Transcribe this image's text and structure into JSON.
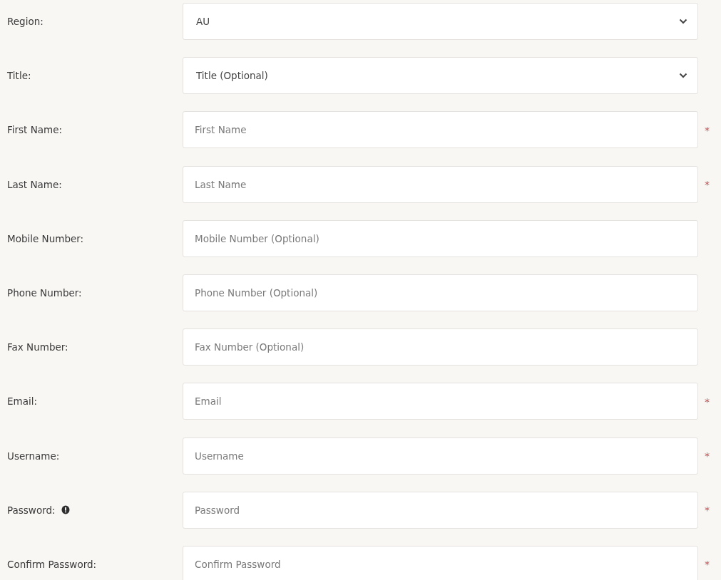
{
  "form": {
    "fields": [
      {
        "label": "Region:",
        "kind": "select",
        "value": "AU"
      },
      {
        "label": "Title:",
        "kind": "select",
        "value": "Title (Optional)"
      },
      {
        "label": "First Name:",
        "kind": "text",
        "placeholder": "First Name",
        "required_mark": "*"
      },
      {
        "label": "Last Name:",
        "kind": "text",
        "placeholder": "Last Name",
        "required_mark": "*"
      },
      {
        "label": "Mobile Number:",
        "kind": "text",
        "placeholder": "Mobile Number (Optional)"
      },
      {
        "label": "Phone Number:",
        "kind": "text",
        "placeholder": "Phone Number (Optional)"
      },
      {
        "label": "Fax Number:",
        "kind": "text",
        "placeholder": "Fax Number (Optional)"
      },
      {
        "label": "Email:",
        "kind": "text",
        "placeholder": "Email",
        "required_mark": "*"
      },
      {
        "label": "Username:",
        "kind": "text",
        "placeholder": "Username",
        "required_mark": "*"
      },
      {
        "label": "Password:",
        "kind": "text",
        "placeholder": "Password",
        "required_mark": "*",
        "info": true
      },
      {
        "label": "Confirm Password:",
        "kind": "text",
        "placeholder": "Confirm Password",
        "required_mark": "*"
      }
    ]
  }
}
